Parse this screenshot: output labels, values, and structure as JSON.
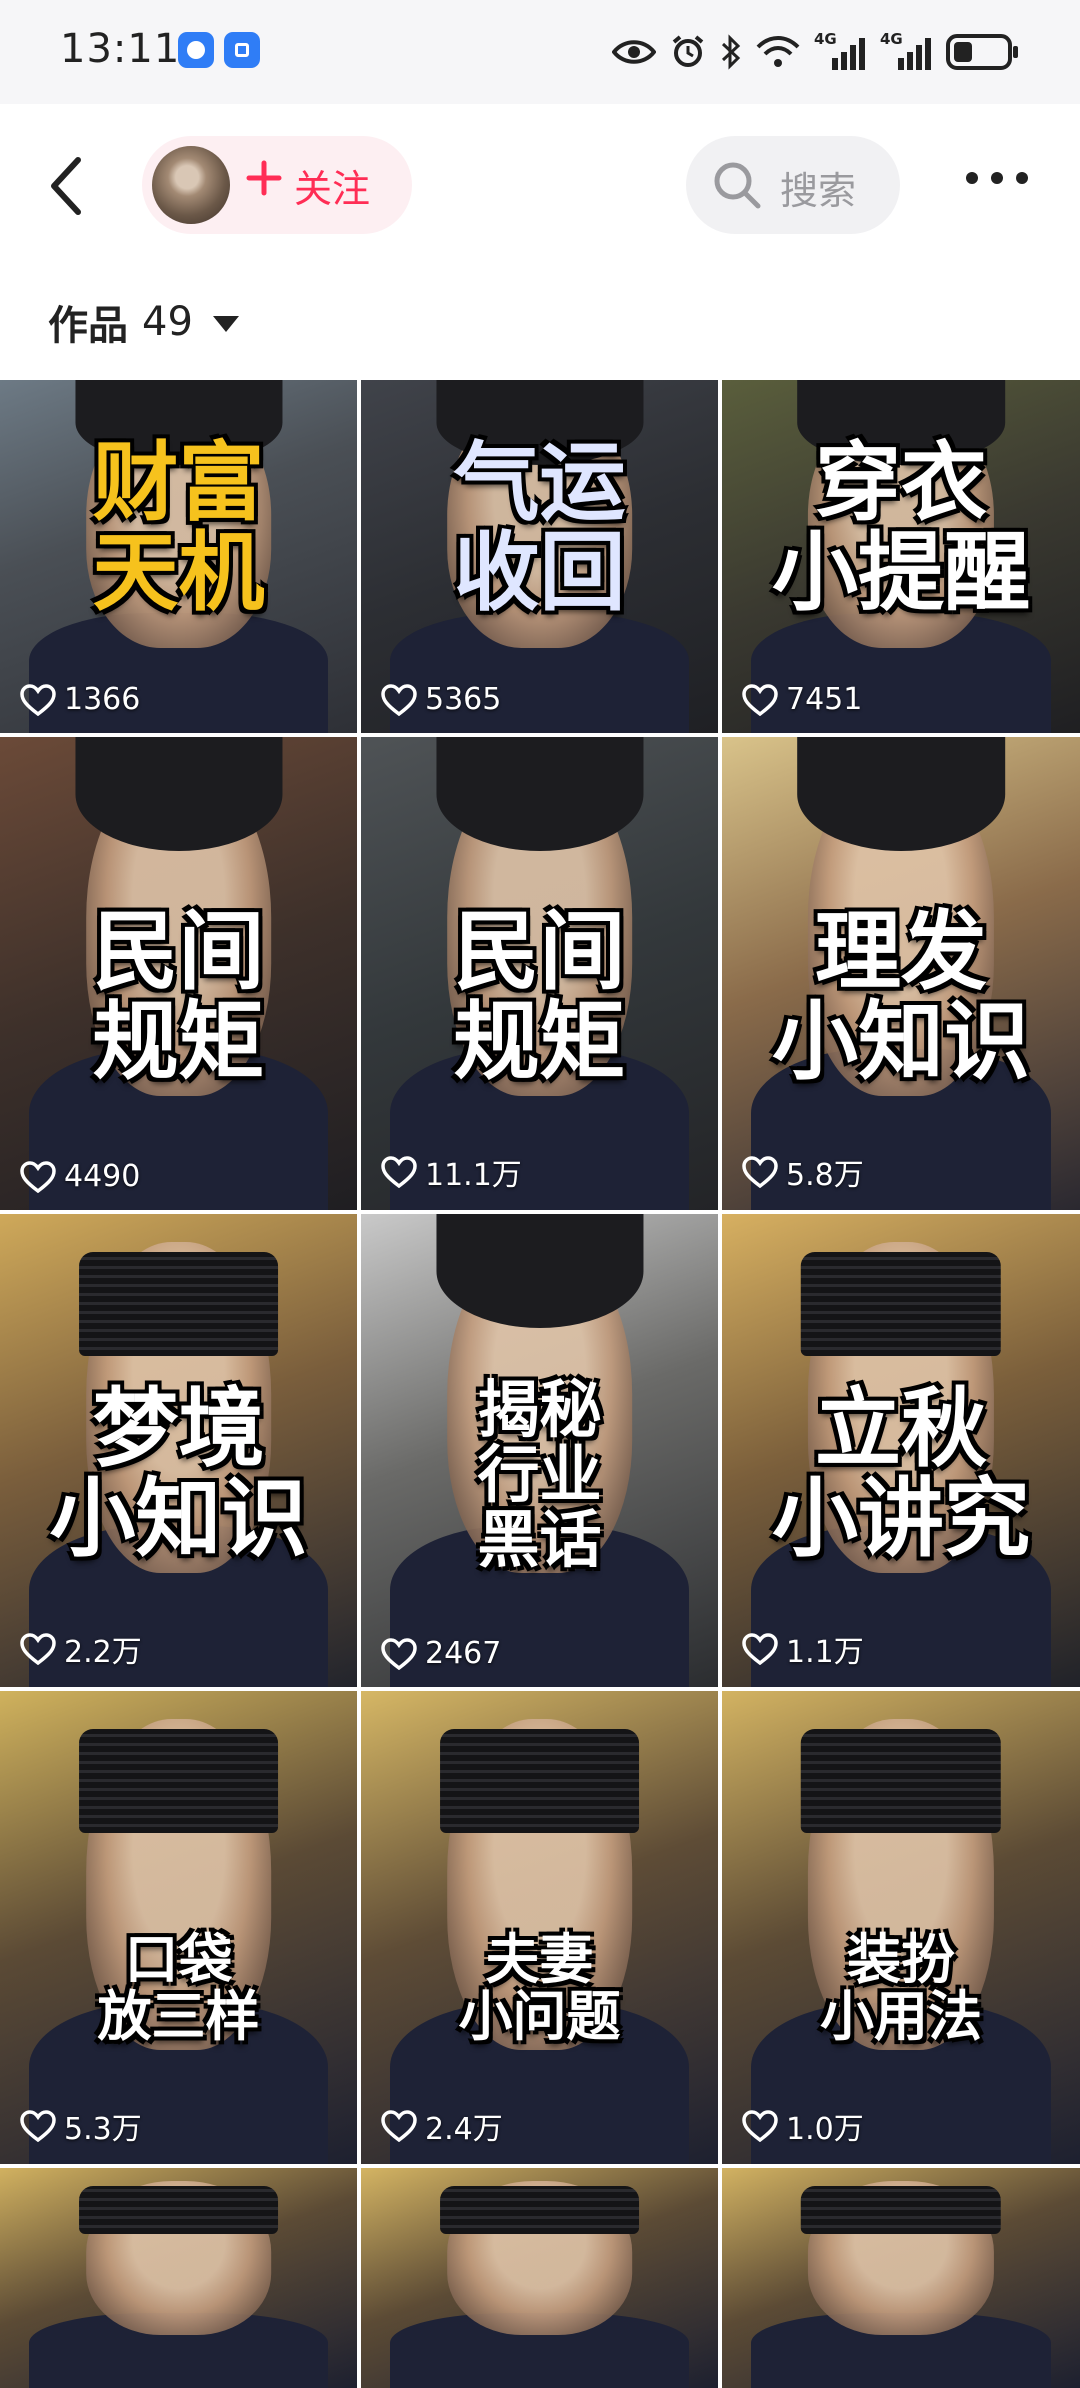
{
  "status_bar": {
    "time": "13:11",
    "network_labels": [
      "4G",
      "4G"
    ],
    "icons": [
      "app-icon-1",
      "app-icon-2",
      "eye-icon",
      "alarm-icon",
      "bluetooth-icon",
      "wifi-icon",
      "signal-icon",
      "signal-icon",
      "battery-icon"
    ]
  },
  "header": {
    "follow_label": "关注",
    "search_label": "搜索",
    "accent_color": "#ff2d55"
  },
  "works": {
    "label": "作品",
    "count": "49"
  },
  "videos": [
    {
      "title_lines": [
        "财富",
        "天机"
      ],
      "likes": "1366",
      "title_color": "#f6c21d"
    },
    {
      "title_lines": [
        "气运",
        "收回"
      ],
      "likes": "5365",
      "title_color": "#dfe6ff"
    },
    {
      "title_lines": [
        "穿衣",
        "小提醒"
      ],
      "likes": "7451",
      "title_color": "#ffffff"
    },
    {
      "title_lines": [
        "民间",
        "规矩"
      ],
      "likes": "4490",
      "title_color": "#ffffff"
    },
    {
      "title_lines": [
        "民间",
        "规矩"
      ],
      "likes": "11.1万",
      "title_color": "#ffffff"
    },
    {
      "title_lines": [
        "理发",
        "小知识"
      ],
      "likes": "5.8万",
      "title_color": "#ffffff"
    },
    {
      "title_lines": [
        "梦境",
        "小知识"
      ],
      "likes": "2.2万",
      "title_color": "#ffffff"
    },
    {
      "title_lines": [
        "揭秘",
        "行业",
        "黑话"
      ],
      "likes": "2467",
      "title_color": "#ffffff"
    },
    {
      "title_lines": [
        "立秋",
        "小讲究"
      ],
      "likes": "1.1万",
      "title_color": "#ffffff"
    },
    {
      "title_lines": [
        "口袋",
        "放三样"
      ],
      "likes": "5.3万",
      "title_color": "#ffffff"
    },
    {
      "title_lines": [
        "夫妻",
        "小问题"
      ],
      "likes": "2.4万",
      "title_color": "#ffffff"
    },
    {
      "title_lines": [
        "装扮",
        "小用法"
      ],
      "likes": "1.0万",
      "title_color": "#ffffff"
    },
    {
      "title_lines": [],
      "likes": "",
      "title_color": "#ffffff"
    },
    {
      "title_lines": [],
      "likes": "",
      "title_color": "#ffffff"
    },
    {
      "title_lines": [],
      "likes": "",
      "title_color": "#ffffff"
    }
  ]
}
